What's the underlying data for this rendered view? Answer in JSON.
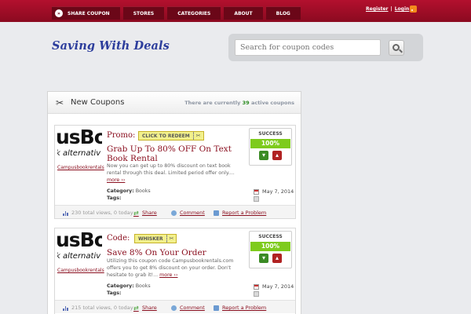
{
  "nav": {
    "items": [
      "SHARE COUPON",
      "STORES",
      "CATEGORIES",
      "ABOUT",
      "BLOG"
    ],
    "register": "Register",
    "login": "Login",
    "separator": "|"
  },
  "header": {
    "logo": "Saving With Deals",
    "search_placeholder": "Search for coupon codes"
  },
  "panel": {
    "title": "New Coupons",
    "count_prefix": "There are currently",
    "count": "39",
    "count_suffix": "active coupons"
  },
  "coupons": [
    {
      "logo_line1": "usBo",
      "logo_line2": "k alternativ",
      "store": "Campusbookrentals",
      "type": "Promo:",
      "badge": "CLICK TO REDEEM",
      "title": "Grab Up To 80% OFF On Text Book Rental",
      "description": "Now you can get up to 80% discount on text book rental through this deal. Limited period offer only....",
      "more": "more ››",
      "category_label": "Category:",
      "category": "Books",
      "tags_label": "Tags:",
      "success_label": "SUCCESS",
      "success_pct": "100%",
      "date": "May 7, 2014",
      "views": "230 total views, 0 today",
      "share": "Share",
      "comment": "Comment",
      "report": "Report a Problem"
    },
    {
      "logo_line1": "usBo",
      "logo_line2": "k alternativ",
      "store": "Campusbookrentals",
      "type": "Code:",
      "badge": "WHISKER",
      "title": "Save 8% On Your Order",
      "description": "Utilizing this coupon code Campusbookrentals.com offers you to get 8% discount on your order. Don't hesitate to grab it!...",
      "more": "more ››",
      "category_label": "Category:",
      "category": "Books",
      "tags_label": "Tags:",
      "success_label": "SUCCESS",
      "success_pct": "100%",
      "date": "May 7, 2014",
      "views": "215 total views, 0 today",
      "share": "Share",
      "comment": "Comment",
      "report": "Report a Problem"
    }
  ]
}
